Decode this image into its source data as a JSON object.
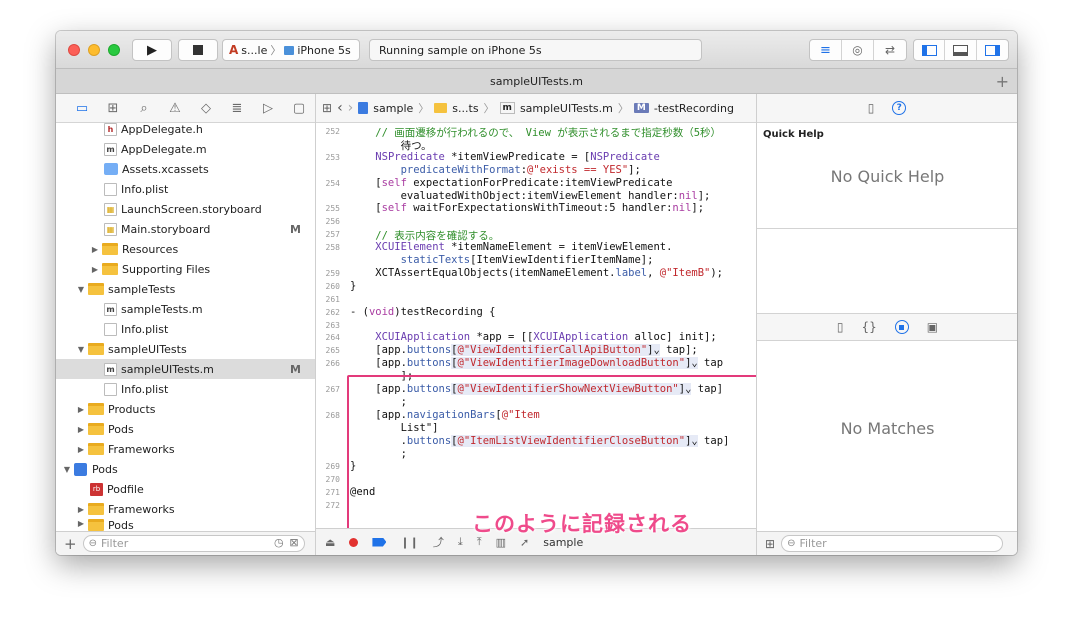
{
  "toolbar": {
    "scheme_target": "s...le",
    "scheme_device": "iPhone 5s",
    "status": "Running sample on iPhone 5s"
  },
  "tab": {
    "title": "sampleUITests.m"
  },
  "navigator": {
    "items": [
      {
        "label": "AppDelegate.h",
        "icon": "h",
        "mark": ""
      },
      {
        "label": "AppDelegate.m",
        "icon": "m",
        "mark": ""
      },
      {
        "label": "Assets.xcassets",
        "icon": "assets",
        "mark": ""
      },
      {
        "label": "Info.plist",
        "icon": "plist",
        "mark": ""
      },
      {
        "label": "LaunchScreen.storyboard",
        "icon": "storyboard",
        "mark": ""
      },
      {
        "label": "Main.storyboard",
        "icon": "storyboard",
        "mark": "M"
      },
      {
        "label": "Resources",
        "icon": "folder",
        "mark": ""
      },
      {
        "label": "Supporting Files",
        "icon": "folder",
        "mark": ""
      },
      {
        "label": "sampleTests",
        "icon": "folder",
        "mark": ""
      },
      {
        "label": "sampleTests.m",
        "icon": "m",
        "mark": ""
      },
      {
        "label": "Info.plist",
        "icon": "plist",
        "mark": ""
      },
      {
        "label": "sampleUITests",
        "icon": "folder",
        "mark": ""
      },
      {
        "label": "sampleUITests.m",
        "icon": "m",
        "mark": "M"
      },
      {
        "label": "Info.plist",
        "icon": "plist",
        "mark": ""
      },
      {
        "label": "Products",
        "icon": "folder",
        "mark": ""
      },
      {
        "label": "Pods",
        "icon": "folder",
        "mark": ""
      },
      {
        "label": "Frameworks",
        "icon": "folder",
        "mark": ""
      },
      {
        "label": "Pods",
        "icon": "project",
        "mark": ""
      },
      {
        "label": "Podfile",
        "icon": "ruby",
        "mark": ""
      },
      {
        "label": "Frameworks",
        "icon": "folder",
        "mark": ""
      },
      {
        "label": "Pods",
        "icon": "folder",
        "mark": ""
      }
    ],
    "filter_placeholder": "Filter"
  },
  "jumpbar": {
    "project": "sample",
    "group": "s...ts",
    "file": "sampleUITests.m",
    "method": "-testRecording"
  },
  "code": {
    "line_numbers": [
      "252",
      "",
      "253",
      "",
      "254",
      "",
      "255",
      "256",
      "257",
      "258",
      "",
      "259",
      "260",
      "261",
      "262",
      "263",
      "264",
      "265",
      "266",
      "",
      "267",
      "",
      "268",
      "",
      "",
      "",
      "269",
      "270",
      "271",
      "272"
    ],
    "lines": [
      "    // 画面遷移が行われるので、 View が表示されるまで指定秒数（5秒）",
      "        待つ。",
      "    NSPredicate *itemViewPredicate = [NSPredicate",
      "        predicateWithFormat:@\"exists == YES\"];",
      "    [self expectationForPredicate:itemViewPredicate",
      "        evaluatedWithObject:itemViewElement handler:nil];",
      "    [self waitForExpectationsWithTimeout:5 handler:nil];",
      "",
      "    // 表示内容を確認する。",
      "    XCUIElement *itemNameElement = itemViewElement.",
      "        staticTexts[ItemViewIdentifierItemName];",
      "    XCTAssertEqualObjects(itemNameElement.label, @\"ItemB\");",
      "}",
      "",
      "- (void)testRecording {",
      "",
      "    XCUIApplication *app = [[XCUIApplication alloc] init];",
      "    [app.buttons[@\"ViewIdentifierCallApiButton\"]⌄ tap];",
      "    [app.buttons[@\"ViewIdentifierImageDownloadButton\"]⌄ tap",
      "        ];",
      "    [app.buttons[@\"ViewIdentifierShowNextViewButton\"]⌄ tap]",
      "        ;",
      "    [app.navigationBars[@\"Item",
      "        List\"]",
      "        .buttons[@\"ItemListViewIdentifierCloseButton\"]⌄ tap]",
      "        ;",
      "}",
      "",
      "@end",
      ""
    ]
  },
  "annotation": "このように記録される",
  "debug": {
    "target": "sample"
  },
  "inspector": {
    "quick_help_title": "Quick Help",
    "quick_help_message": "No Quick Help",
    "library_message": "No Matches",
    "filter_placeholder": "Filter"
  }
}
